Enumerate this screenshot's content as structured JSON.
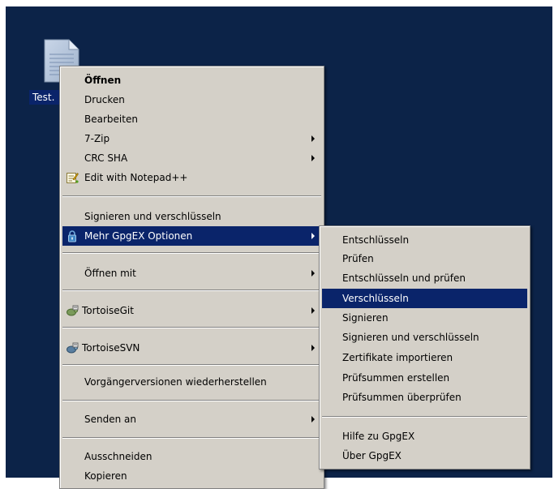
{
  "desktop": {
    "background_color": "#0c2348",
    "file_label": "Test.",
    "file_icon": "text-file-icon"
  },
  "context_menu": {
    "items": [
      {
        "label": "Öffnen"
      },
      {
        "label": "Drucken"
      },
      {
        "label": "Bearbeiten"
      },
      {
        "label": "7-Zip",
        "submenu": true
      },
      {
        "label": "CRC SHA",
        "submenu": true
      },
      {
        "label": "Edit with Notepad++",
        "icon": "notepad-plus-plus-icon"
      },
      {
        "label": "Signieren und verschlüsseln"
      },
      {
        "label": "Mehr GpgEX Optionen",
        "icon": "lock-icon",
        "submenu": true,
        "highlighted": true
      },
      {
        "label": "Öffnen mit",
        "submenu": true
      },
      {
        "label": "TortoiseGit",
        "icon": "tortoisegit-icon",
        "submenu": true
      },
      {
        "label": "TortoiseSVN",
        "icon": "tortoisesvn-icon",
        "submenu": true
      },
      {
        "label": "Vorgängerversionen wiederherstellen"
      },
      {
        "label": "Senden an",
        "submenu": true
      },
      {
        "label": "Ausschneiden"
      },
      {
        "label": "Kopieren"
      }
    ]
  },
  "gpgex_submenu": {
    "items": [
      {
        "label": "Entschlüsseln"
      },
      {
        "label": "Prüfen"
      },
      {
        "label": "Entschlüsseln und prüfen"
      },
      {
        "label": "Verschlüsseln",
        "highlighted": true
      },
      {
        "label": "Signieren"
      },
      {
        "label": "Signieren und verschlüsseln"
      },
      {
        "label": "Zertifikate importieren"
      },
      {
        "label": "Prüfsummen erstellen"
      },
      {
        "label": "Prüfsummen überprüfen"
      },
      {
        "label": "Hilfe zu GpgEX"
      },
      {
        "label": "Über GpgEX"
      }
    ]
  },
  "colors": {
    "menu_background": "#d4d0c8",
    "highlight": "#0a246a",
    "highlight_text": "#ffffff"
  }
}
